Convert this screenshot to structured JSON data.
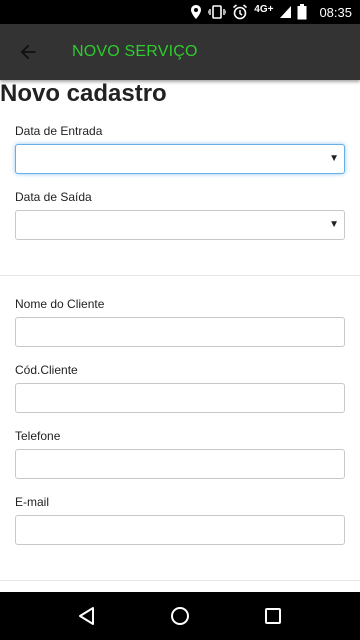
{
  "status_bar": {
    "network": "4G+",
    "time": "08:35",
    "icons": [
      "location-icon",
      "vibrate-icon",
      "alarm-icon",
      "signal-icon",
      "battery-icon"
    ]
  },
  "app_bar": {
    "title": "NOVO SERVIÇO",
    "title_color": "#2ecc2e",
    "background": "#333333"
  },
  "page": {
    "title": "Novo cadastro"
  },
  "form": {
    "data_entrada": {
      "label": "Data de Entrada",
      "value": ""
    },
    "data_saida": {
      "label": "Data de Saída",
      "value": ""
    },
    "nome_cliente": {
      "label": "Nome do Cliente",
      "value": ""
    },
    "cod_cliente": {
      "label": "Cód.Cliente",
      "value": ""
    },
    "telefone": {
      "label": "Telefone",
      "value": ""
    },
    "email": {
      "label": "E-mail",
      "value": ""
    }
  },
  "nav_bar": {
    "buttons": [
      "back-icon",
      "home-icon",
      "recents-icon"
    ]
  }
}
